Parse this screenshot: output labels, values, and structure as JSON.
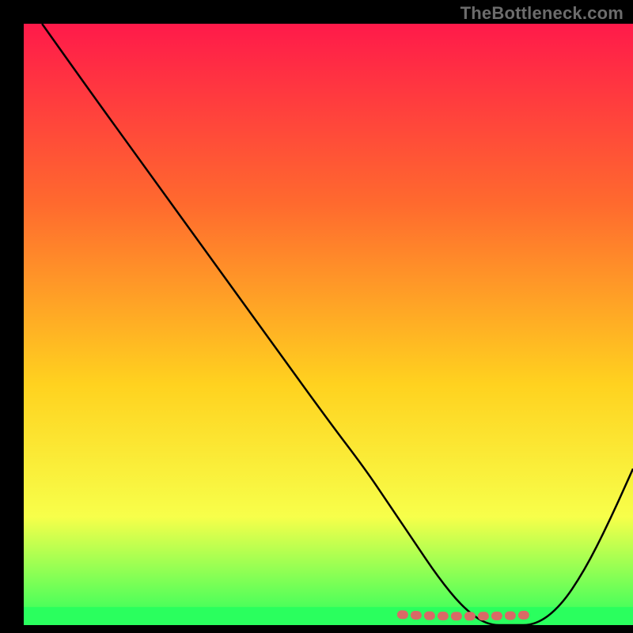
{
  "attribution": "TheBottleneck.com",
  "colors": {
    "background": "#000000",
    "grad_top": "#ff1a4a",
    "grad_mid1": "#ff6a2e",
    "grad_mid2": "#ffd21f",
    "grad_mid3": "#f7ff4a",
    "grad_bottom": "#2aff5e",
    "curve": "#000000",
    "marker": "#d96a66"
  },
  "chart_data": {
    "type": "line",
    "title": "",
    "xlabel": "",
    "ylabel": "",
    "xlim": [
      0,
      100
    ],
    "ylim": [
      0,
      100
    ],
    "x": [
      3,
      10,
      20,
      30,
      40,
      50,
      56,
      60,
      64,
      68,
      72,
      76,
      80,
      84,
      88,
      92,
      96,
      100
    ],
    "values": [
      100,
      90,
      76,
      62,
      48,
      34,
      26,
      20,
      14,
      8,
      3,
      0,
      0,
      0,
      3,
      9,
      17,
      26
    ],
    "marker_band": {
      "x_start": 62,
      "x_end": 84,
      "y": 2
    },
    "green_floor_y": 3
  }
}
